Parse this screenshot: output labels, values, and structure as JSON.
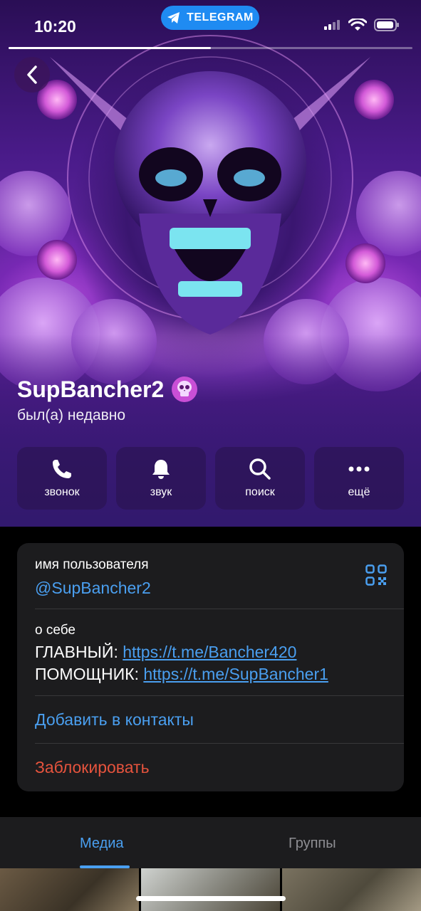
{
  "status_bar": {
    "time": "10:20",
    "app_pill": "TELEGRAM",
    "story_progress": 0.5
  },
  "profile": {
    "name": "SupBancher2",
    "last_seen": "был(а) недавно",
    "emoji_status_icon": "skull-icon"
  },
  "actions": [
    {
      "label": "звонок",
      "icon": "phone-icon"
    },
    {
      "label": "звук",
      "icon": "bell-icon"
    },
    {
      "label": "поиск",
      "icon": "search-icon"
    },
    {
      "label": "ещё",
      "icon": "more-icon"
    }
  ],
  "info": {
    "username_label": "имя пользователя",
    "username": "@SupBancher2",
    "bio_label": "о себе",
    "bio_line1_prefix": "ГЛАВНЫЙ: ",
    "bio_line1_link": "https://t.me/Bancher420",
    "bio_line2_prefix": "ПОМОЩНИК: ",
    "bio_line2_link": "https://t.me/SupBancher1",
    "add_contact": "Добавить в контакты",
    "block": "Заблокировать"
  },
  "tabs": [
    {
      "label": "Медиа",
      "active": true
    },
    {
      "label": "Группы",
      "active": false
    }
  ],
  "colors": {
    "accent": "#4a9ff0",
    "danger": "#e5533d",
    "card": "#1c1c1e",
    "telegram": "#1f8bf2"
  }
}
